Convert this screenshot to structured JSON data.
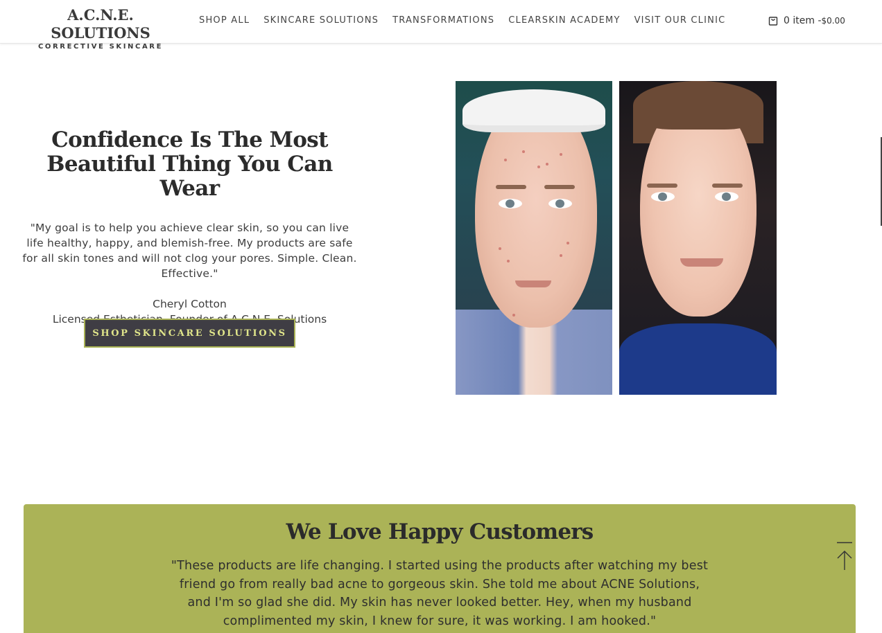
{
  "header": {
    "logo_main": "A.C.N.E. SOLUTIONS",
    "logo_sub": "CORRECTIVE SKINCARE",
    "nav": [
      {
        "label": "SHOP ALL"
      },
      {
        "label": "SKINCARE SOLUTIONS"
      },
      {
        "label": "TRANSFORMATIONS"
      },
      {
        "label": "CLEARSKIN ACADEMY"
      },
      {
        "label": "VISIT OUR CLINIC"
      }
    ],
    "cart": {
      "icon": "shopping-bag-icon",
      "count_label": "0 item -",
      "total": "$0.00"
    }
  },
  "hero": {
    "title": "Confidence Is The Most Beautiful Thing You Can Wear",
    "quote": "\"My goal is to help you achieve clear skin, so you can live life healthy, happy, and blemish-free. My products are safe for all skin tones and will not clog your pores. Simple. Clean. Effective.\"",
    "author": "Cheryl Cotton",
    "role": "Licensed Esthetician, Founder of A.C.N.E. Solutions",
    "cta_label": "SHOP SKINCARE SOLUTIONS"
  },
  "testimonials": {
    "title": "We Love Happy Customers",
    "quote": "\"These products are life changing. I started using the products after watching my best friend go from really bad acne to gorgeous skin. She told me about ACNE Solutions, and I'm so glad she did. My skin has never looked better. Hey, when my husband complimented my skin, I knew for sure, it was working. I am hooked.\""
  },
  "colors": {
    "accent_green": "#abb357",
    "button_bg": "#3f3d44",
    "button_text": "#dfe48a"
  }
}
